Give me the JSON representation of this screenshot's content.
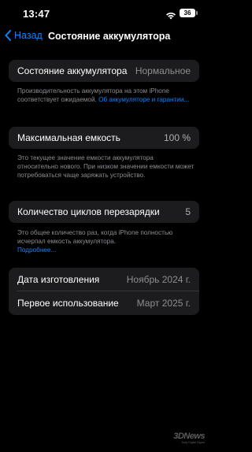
{
  "status": {
    "time": "13:47",
    "battery_level": "36"
  },
  "nav": {
    "back_label": "Назад",
    "title": "Состояние аккумулятора"
  },
  "health": {
    "label": "Состояние аккумулятора",
    "value": "Нормальное",
    "note_text": "Производительность аккумулятора на этом iPhone соответствует ожидаемой. ",
    "note_link": "Об аккумуляторе и гарантии..."
  },
  "capacity": {
    "label": "Максимальная емкость",
    "value": "100 %",
    "note": "Это текущее значение емкости аккумулятора относительно нового. При низком значении емкости может потребоваться чаще заряжать устройство."
  },
  "cycles": {
    "label": "Количество циклов перезарядки",
    "value": "5",
    "note_text": "Это общее количество раз, когда iPhone полностью исчерпал емкость аккумулятора.",
    "note_link": "Подробнее..."
  },
  "dates": {
    "manufacture_label": "Дата изготовления",
    "manufacture_value": "Ноябрь 2024 г.",
    "first_use_label": "Первое использование",
    "first_use_value": "Март 2025 г."
  },
  "watermark": {
    "brand": "3DNews",
    "tagline": "Daily Digital Digest"
  },
  "colors": {
    "accent": "#0a84ff",
    "background": "#000000",
    "cell": "#1c1c1e",
    "secondary_text": "#8e8e93"
  },
  "icons": [
    "wifi-icon",
    "battery-icon",
    "chevron-left-icon"
  ]
}
